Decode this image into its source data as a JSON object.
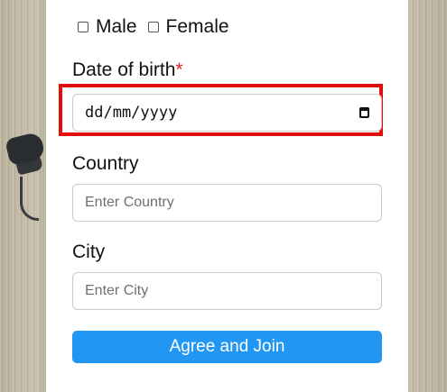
{
  "form": {
    "gender_options": [
      "Male",
      "Female"
    ],
    "dob_label": "Date of birth",
    "dob_required_marker": "*",
    "dob_placeholder": "dd/mm/yyyy",
    "country_label": "Country",
    "country_placeholder": "Enter Country",
    "city_label": "City",
    "city_placeholder": "Enter City",
    "submit_label": "Agree and Join"
  },
  "icons": {
    "date_picker": "calendar-icon",
    "checkbox": "empty-checkbox"
  },
  "colors": {
    "accent": "#2196f3",
    "highlight": "#e20d0d",
    "required": "#dd2222"
  }
}
